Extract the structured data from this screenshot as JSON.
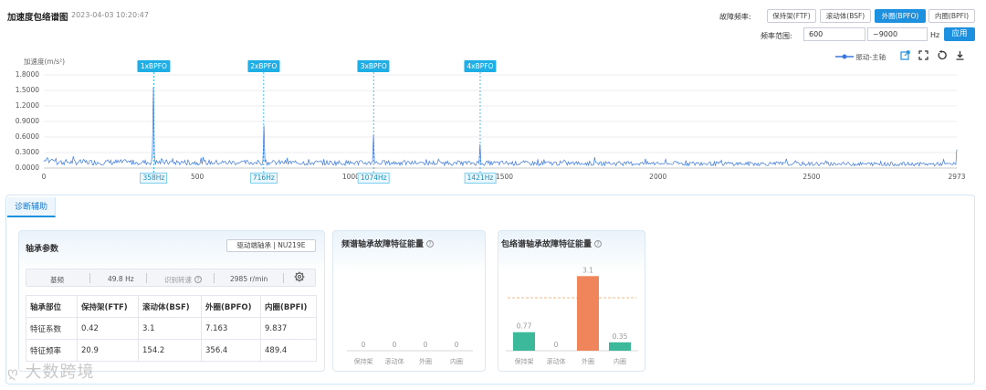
{
  "header": {
    "title": "加速度包络谱图",
    "timestamp": "2023-04-03 10:20:47"
  },
  "fault_freq": {
    "label": "故障频率:",
    "options": [
      "保持架(FTF)",
      "滚动体(BSF)",
      "外圈(BPFO)",
      "内圈(BPFI)"
    ],
    "active": "外圈(BPFO)"
  },
  "freq_range": {
    "label": "频率范围:",
    "min": "600",
    "max": "~9000",
    "unit": "Hz",
    "apply_label": "应用"
  },
  "legend": {
    "label": "振动-主轴",
    "color": "#3a78e0"
  },
  "toolbar_icons": [
    "export-icon",
    "fullscreen-icon",
    "reset-icon",
    "download-icon"
  ],
  "chart_data": {
    "type": "line",
    "ylabel": "加速度(m/s²)",
    "yticks": [
      "1.8000",
      "1.5000",
      "1.2000",
      "0.9000",
      "0.6000",
      "0.3000",
      "0.0000"
    ],
    "ylim": [
      0,
      1.8
    ],
    "xlim": [
      0,
      2973
    ],
    "xticks": [
      "0",
      "500",
      "1000",
      "1500",
      "2000",
      "2500",
      "2973"
    ],
    "grid": true,
    "series": [
      {
        "name": "振动-主轴",
        "color": "#3a78e0",
        "peaks": [
          [
            358,
            1.56
          ],
          [
            716,
            0.82
          ],
          [
            1074,
            0.64
          ],
          [
            1421,
            0.46
          ]
        ],
        "noise_level": 0.17
      }
    ],
    "markers": [
      {
        "label": "1xBPFO",
        "freq_label": "358Hz",
        "x": 358
      },
      {
        "label": "2xBPFO",
        "freq_label": "716Hz",
        "x": 716
      },
      {
        "label": "3xBPFO",
        "freq_label": "1074Hz",
        "x": 1074
      },
      {
        "label": "4xBPFO",
        "freq_label": "1421Hz",
        "x": 1421
      }
    ]
  },
  "diagnosis": {
    "tab_label": "诊断辅助",
    "bearing": {
      "title": "轴承参数",
      "drive_label": "驱动端轴承 | NU219E",
      "base_freq_label": "基频",
      "base_freq_value": "49.8 Hz",
      "speed_label": "识别转速",
      "speed_value": "2985 r/min",
      "table_headers": [
        "轴承部位",
        "保持架(FTF)",
        "滚动体(BSF)",
        "外圈(BPFO)",
        "内圈(BPFI)"
      ],
      "rows": [
        [
          "特征系数",
          "0.42",
          "3.1",
          "7.163",
          "9.837"
        ],
        [
          "特征频率",
          "20.9",
          "154.2",
          "356.4",
          "489.4"
        ]
      ]
    },
    "spectrum_energy": {
      "title": "频谱轴承故障特征能量",
      "chart_data": {
        "type": "bar",
        "categories": [
          "保持架",
          "滚动体",
          "外圈",
          "内圈"
        ],
        "values": [
          0,
          0,
          0,
          0
        ]
      }
    },
    "envelope_energy": {
      "title": "包络谱轴承故障特征能量",
      "chart_data": {
        "type": "bar",
        "categories": [
          "保持架",
          "滚动体",
          "外圈",
          "内圈"
        ],
        "values": [
          0.77,
          0,
          3.1,
          0.35
        ],
        "value_labels": [
          "0.77",
          "0",
          "3.1",
          "0.35"
        ],
        "threshold": 2.2,
        "ylim": [
          0,
          3.3
        ]
      }
    }
  },
  "watermark": "大数跨境"
}
